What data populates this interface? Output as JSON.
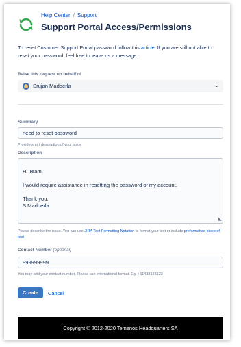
{
  "header": {
    "breadcrumb": [
      "Help Center",
      "Support"
    ],
    "breadcrumb_separator": "/",
    "title": "Support Portal Access/Permissions"
  },
  "intro": {
    "before_link": "To reset Customer Support Portal password follow this ",
    "link_text": "article",
    "after_link": ". If you are still not able to reset your password, feel free to leave us a message."
  },
  "raise_on_behalf": {
    "label": "Raise this request on behalf of",
    "value": "Srujan Madderla"
  },
  "summary": {
    "label": "Summary",
    "value": "need to reset password",
    "help": "Provide short description of your issue"
  },
  "description": {
    "label": "Description",
    "value": "Hi Team,\n\nI would require assistance in resetting the password of my account.\n\nThank you,\nS Madderla",
    "help_before": "Please describe the issue. You can use ",
    "help_link1": "JIRA Text Formatting Notation",
    "help_middle": " to format your text or include ",
    "help_link2": "preformatted piece of text"
  },
  "contact": {
    "label": "Contact Number",
    "optional": "(optional)",
    "value": "999999999",
    "help": "You may add your contact number. Please use international format. Eg. +61438123123"
  },
  "actions": {
    "create": "Create",
    "cancel": "Cancel"
  },
  "footer": {
    "text": "Copyright © 2012-2020 Temenos Headquarters SA"
  },
  "colors": {
    "accent": "#0052cc",
    "create_button": "#3b78c4",
    "logo_green": "#36a852",
    "footer_bg": "#000000"
  },
  "icons": {
    "logo": "refresh-arrows-icon",
    "select_chevron": "chevron-down-icon",
    "avatar": "user-avatar"
  }
}
